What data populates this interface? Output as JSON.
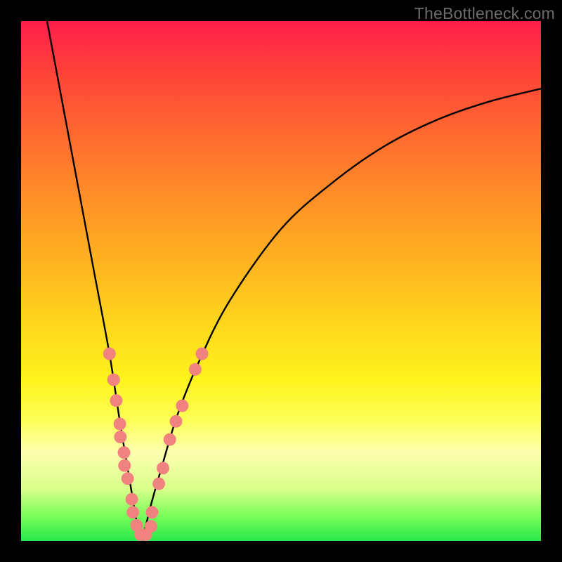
{
  "watermark": "TheBottleneck.com",
  "colors": {
    "frame": "#000000",
    "curve": "#000000",
    "marker_fill": "#f0837f",
    "marker_stroke": "#e37572"
  },
  "chart_data": {
    "type": "line",
    "title": "",
    "xlabel": "",
    "ylabel": "",
    "xlim": [
      0,
      100
    ],
    "ylim": [
      0,
      100
    ],
    "series": [
      {
        "name": "bottleneck-curve",
        "description": "V-shaped bottleneck curve; x is relative component balance (0–100), y is bottleneck percentage (0–100). Minimum near x≈23.",
        "x": [
          5,
          8,
          11,
          14,
          17,
          19,
          21,
          22,
          23,
          24,
          25,
          27,
          30,
          34,
          40,
          50,
          60,
          70,
          80,
          90,
          100
        ],
        "values": [
          100,
          84,
          68,
          52,
          36,
          23,
          11,
          5,
          0,
          3,
          7,
          14,
          24,
          34,
          46,
          60,
          69,
          76,
          81,
          84.5,
          87
        ]
      }
    ],
    "markers": {
      "name": "sample-points",
      "description": "Highlighted sampled points along the curve near the trough.",
      "points": [
        {
          "x": 17.0,
          "y": 36.0
        },
        {
          "x": 17.8,
          "y": 31.0
        },
        {
          "x": 18.3,
          "y": 27.0
        },
        {
          "x": 19.0,
          "y": 22.5
        },
        {
          "x": 19.1,
          "y": 20.0
        },
        {
          "x": 19.8,
          "y": 17.0
        },
        {
          "x": 19.9,
          "y": 14.5
        },
        {
          "x": 20.5,
          "y": 12.0
        },
        {
          "x": 21.3,
          "y": 8.0
        },
        {
          "x": 21.5,
          "y": 5.5
        },
        {
          "x": 22.2,
          "y": 3.0
        },
        {
          "x": 23.0,
          "y": 1.2
        },
        {
          "x": 24.0,
          "y": 1.2
        },
        {
          "x": 25.0,
          "y": 2.8
        },
        {
          "x": 25.2,
          "y": 5.5
        },
        {
          "x": 26.5,
          "y": 11.0
        },
        {
          "x": 27.3,
          "y": 14.0
        },
        {
          "x": 28.6,
          "y": 19.5
        },
        {
          "x": 29.8,
          "y": 23.0
        },
        {
          "x": 31.0,
          "y": 26.0
        },
        {
          "x": 33.5,
          "y": 33.0
        },
        {
          "x": 34.8,
          "y": 36.0
        }
      ]
    }
  }
}
